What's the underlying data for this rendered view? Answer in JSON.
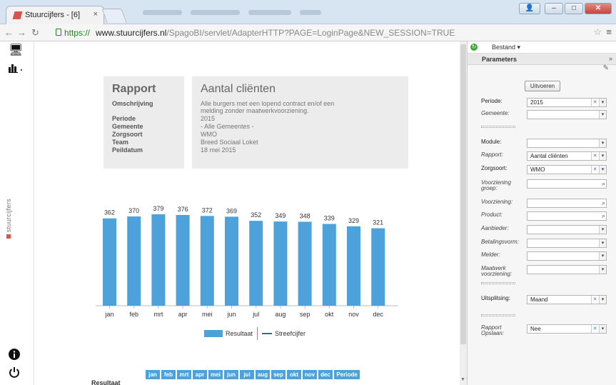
{
  "browser": {
    "tab_title": "Stuurcijfers - [6]",
    "tab_close": "×",
    "url_https": "https://",
    "url_host": "www.stuurcijfers.nl",
    "url_path": "/SpagoBI/servlet/AdapterHTTP?PAGE=LoginPage&NEW_SESSION=TRUE"
  },
  "rail": {
    "logo_text": "stuurcijfers"
  },
  "report": {
    "left_title": "Rapport",
    "right_title": "Aantal cliënten",
    "labels": [
      "Omschrijving",
      "Periode",
      "Gemeente",
      "Zorgsoort",
      "Team",
      "Peildatum"
    ],
    "description": "Alle burgers met een lopend contract en/of een melding zonder maatwerkvoorziening.",
    "values": [
      "2015",
      "- Alle Gemeentes -",
      "WMO",
      "Breed Sociaal Loket",
      "18 mei 2015"
    ]
  },
  "chart_data": {
    "type": "bar",
    "categories": [
      "jan",
      "feb",
      "mrt",
      "apr",
      "mei",
      "jun",
      "jul",
      "aug",
      "sep",
      "okt",
      "nov",
      "dec"
    ],
    "series": [
      {
        "name": "Resultaat",
        "values": [
          362,
          370,
          379,
          376,
          372,
          369,
          352,
          349,
          348,
          339,
          329,
          321
        ]
      }
    ],
    "legend": [
      "Resultaat",
      "Streefcijfer"
    ],
    "bar_color": "#4da2dc",
    "ylim": [
      0,
      400
    ]
  },
  "table": {
    "headers": [
      "jan",
      "feb",
      "mrt",
      "apr",
      "mei",
      "jun",
      "jul",
      "aug",
      "sep",
      "okt",
      "nov",
      "dec",
      "Periode"
    ],
    "row_label": "Resultaat"
  },
  "panel": {
    "menu": "Bestand ▾",
    "title": "Parameters",
    "run_button": "Uitvoeren",
    "params": [
      {
        "label": "Periode:",
        "value": "2015",
        "italic": false,
        "kind": "clear-select"
      },
      {
        "label": "Gemeente:",
        "value": "",
        "italic": true,
        "kind": "select"
      },
      {
        "label": "Module:",
        "value": "",
        "italic": false,
        "kind": "select"
      },
      {
        "label": "Rapport:",
        "value": "Aantal cliënten",
        "italic": true,
        "kind": "clear-select"
      },
      {
        "label": "Zorgsoort:",
        "value": "WMO",
        "italic": false,
        "kind": "clear-select"
      },
      {
        "label": "Voorziening groep:",
        "value": "",
        "italic": true,
        "kind": "search"
      },
      {
        "label": "Voorziening:",
        "value": "",
        "italic": true,
        "kind": "search"
      },
      {
        "label": "Product:",
        "value": "",
        "italic": true,
        "kind": "search"
      },
      {
        "label": "Aanbieder:",
        "value": "",
        "italic": true,
        "kind": "select"
      },
      {
        "label": "Betalingsvorm:",
        "value": "",
        "italic": true,
        "kind": "select"
      },
      {
        "label": "Melder:",
        "value": "",
        "italic": true,
        "kind": "select"
      },
      {
        "label": "Maatwerk voorziening:",
        "value": "",
        "italic": true,
        "kind": "select"
      },
      {
        "label": "Uitsplitsing:",
        "value": "Maand",
        "italic": false,
        "kind": "clear-select"
      },
      {
        "label": "Rapport Opslaan:",
        "value": "Nee",
        "italic": true,
        "kind": "clear-select"
      }
    ]
  }
}
